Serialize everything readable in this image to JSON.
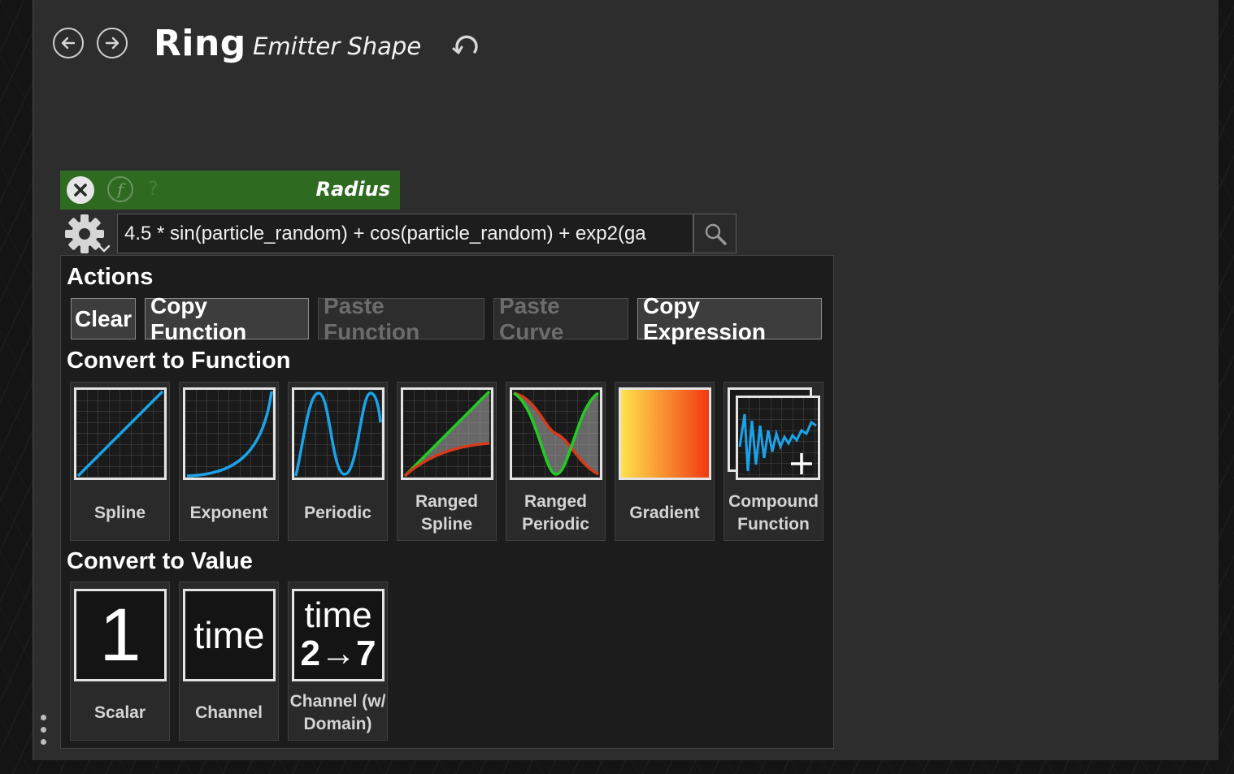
{
  "header": {
    "title": "Ring",
    "subtitle": "Emitter Shape",
    "back_icon": "arrow-left-icon",
    "forward_icon": "arrow-right-icon",
    "refresh_icon": "refresh-icon"
  },
  "parameter": {
    "label": "Radius",
    "header_color": "#2e6b21",
    "expression": "4.5 * sin(particle_random) + cos(particle_random) + exp2(ga",
    "help_glyph": "?",
    "func_glyph": "f"
  },
  "menu": {
    "actions_title": "Actions",
    "actions": [
      {
        "label": "Clear",
        "enabled": true
      },
      {
        "label": "Copy Function",
        "enabled": true
      },
      {
        "label": "Paste Function",
        "enabled": false
      },
      {
        "label": "Paste Curve",
        "enabled": false
      },
      {
        "label": "Copy Expression",
        "enabled": true
      }
    ],
    "function_title": "Convert to Function",
    "functions": [
      {
        "label": "Spline",
        "icon": "spline-icon"
      },
      {
        "label": "Exponent",
        "icon": "exponent-icon"
      },
      {
        "label": "Periodic",
        "icon": "periodic-icon"
      },
      {
        "label": "Ranged\nSpline",
        "icon": "ranged-spline-icon"
      },
      {
        "label": "Ranged\nPeriodic",
        "icon": "ranged-periodic-icon"
      },
      {
        "label": "Gradient",
        "icon": "gradient-icon"
      },
      {
        "label": "Compound\nFunction",
        "icon": "compound-function-icon"
      }
    ],
    "value_title": "Convert to Value",
    "values": [
      {
        "label": "Scalar",
        "glyph": "1"
      },
      {
        "label": "Channel",
        "glyph": "time"
      },
      {
        "label": "Channel (w/\nDomain)",
        "glyph_top": "time",
        "glyph_bottom": "2→7"
      }
    ]
  },
  "colors": {
    "curve_blue": "#1aa3e8",
    "curve_green": "#22cc22",
    "curve_red": "#d63a1a",
    "gradient_start": "#ffe14d",
    "gradient_end": "#f03a12"
  }
}
